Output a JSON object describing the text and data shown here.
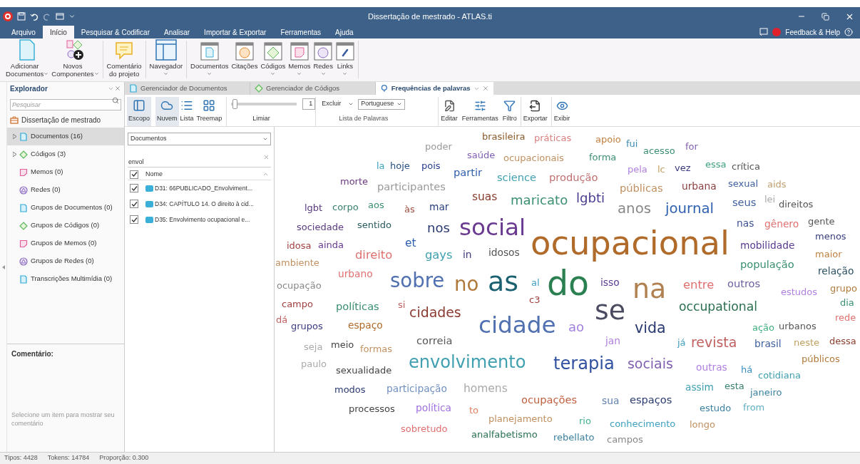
{
  "window": {
    "title": "Dissertação de mestrado - ATLAS.ti"
  },
  "menu_tabs": [
    {
      "label": "Arquivo",
      "selected": false
    },
    {
      "label": "Início",
      "selected": true
    },
    {
      "label": "Pesquisar & Codificar",
      "selected": false
    },
    {
      "label": "Analisar",
      "selected": false
    },
    {
      "label": "Importar & Exportar",
      "selected": false
    },
    {
      "label": "Ferramentas",
      "selected": false
    },
    {
      "label": "Ajuda",
      "selected": false
    }
  ],
  "feedback": "Feedback & Help",
  "ribbon": [
    {
      "kind": "doc",
      "lines": [
        "Adicionar",
        "Documentos"
      ],
      "dropdown": true,
      "group_end": false
    },
    {
      "kind": "components",
      "lines": [
        "Novos",
        "Componentes"
      ],
      "dropdown": true,
      "group_end": true
    },
    {
      "kind": "comment",
      "lines": [
        "Comentário",
        "do projeto"
      ],
      "dropdown": false,
      "group_end": true
    },
    {
      "kind": "navigator",
      "lines": [
        "Navegador"
      ],
      "dropdown": true,
      "group_end": true
    },
    {
      "kind": "documents",
      "lines": [
        "Documentos"
      ],
      "dropdown": true,
      "group_end": false
    },
    {
      "kind": "quotes",
      "lines": [
        "Citações"
      ],
      "dropdown": false,
      "group_end": false
    },
    {
      "kind": "codes",
      "lines": [
        "Códigos"
      ],
      "dropdown": true,
      "group_end": false
    },
    {
      "kind": "memos",
      "lines": [
        "Memos"
      ],
      "dropdown": true,
      "group_end": false
    },
    {
      "kind": "networks",
      "lines": [
        "Redes"
      ],
      "dropdown": true,
      "group_end": false
    },
    {
      "kind": "links",
      "lines": [
        "Links"
      ],
      "dropdown": true,
      "group_end": true
    }
  ],
  "explorer": {
    "title": "Explorador",
    "search_placeholder": "Pesquisar",
    "project": "Dissertação de mestrado",
    "items": [
      {
        "kind": "documents",
        "label": "Documentos (16)",
        "expandable": true,
        "selected": true
      },
      {
        "kind": "codes",
        "label": "Códigos (3)",
        "expandable": true,
        "selected": false
      },
      {
        "kind": "memos",
        "label": "Memos (0)",
        "expandable": false,
        "selected": false
      },
      {
        "kind": "networks",
        "label": "Redes (0)",
        "expandable": false,
        "selected": false
      },
      {
        "kind": "documents",
        "label": "Grupos de Documentos (0)",
        "expandable": false,
        "selected": false
      },
      {
        "kind": "codes",
        "label": "Grupos de Códigos (0)",
        "expandable": false,
        "selected": false
      },
      {
        "kind": "memos",
        "label": "Grupos de Memos (0)",
        "expandable": false,
        "selected": false
      },
      {
        "kind": "networks",
        "label": "Grupos de Redes (0)",
        "expandable": false,
        "selected": false
      },
      {
        "kind": "documents",
        "label": "Transcrições Multimídia (0)",
        "expandable": false,
        "selected": false
      }
    ],
    "comment_title": "Comentário:",
    "comment_hint": "Selecione um item para mostrar seu comentário"
  },
  "doc_tabs": [
    {
      "label": "Gerenciador de Documentos",
      "kind": "documents",
      "selected": false
    },
    {
      "label": "Gerenciador de Códigos",
      "kind": "codes",
      "selected": false
    },
    {
      "label": "Frequências de palavras",
      "kind": "frequency",
      "selected": true
    }
  ],
  "toolbar": {
    "views": [
      {
        "kind": "scope",
        "label": "Escopo",
        "selected": true
      },
      {
        "kind": "cloud",
        "label": "Nuvem",
        "selected": true
      },
      {
        "kind": "list",
        "label": "Lista",
        "selected": false
      },
      {
        "kind": "treemap",
        "label": "Treemap",
        "selected": false
      }
    ],
    "threshold": {
      "level": 0.02,
      "value": "1",
      "label": "Limiar"
    },
    "exclude": "Excluir",
    "language": "Portuguese",
    "word_list_label": "Lista de Palavras",
    "actions": [
      {
        "kind": "edit",
        "label": "Editar"
      },
      {
        "kind": "tools",
        "label": "Ferramentas"
      },
      {
        "kind": "filter",
        "label": "Filtro"
      },
      {
        "kind": "export",
        "label": "Exportar"
      },
      {
        "kind": "view",
        "label": "Exibir"
      }
    ]
  },
  "doc_filter": {
    "scope": "Documentos",
    "search": "envol",
    "header": "Nome",
    "header_checked": true,
    "rows": [
      {
        "name": "D31: 66PUBLICADO_Envolviment...",
        "checked": true
      },
      {
        "name": "D34: CAPÍTULO 14. O direito à cid...",
        "checked": true
      },
      {
        "name": "D35: Envolvimento ocupacional e...",
        "checked": true
      }
    ]
  },
  "word_cloud": [
    {
      "text": "poder",
      "color": "#999999"
    },
    {
      "text": "brasileira",
      "color": "#8a5a2b"
    },
    {
      "text": "práticas",
      "color": "#d98080"
    },
    {
      "text": "apoio",
      "color": "#c08040"
    },
    {
      "text": "fui",
      "color": "#3a8ab0"
    },
    {
      "text": "acesso",
      "color": "#3a9070"
    },
    {
      "text": "for",
      "color": "#8060b0"
    },
    {
      "text": "la",
      "color": "#40a0c0"
    },
    {
      "text": "hoje",
      "color": "#2a5080"
    },
    {
      "text": "pois",
      "color": "#2a4090"
    },
    {
      "text": "saúde",
      "color": "#8060b0"
    },
    {
      "text": "ocupacionais",
      "color": "#c09060"
    },
    {
      "text": "forma",
      "color": "#3a9070"
    },
    {
      "text": "pela",
      "color": "#b080e0"
    },
    {
      "text": "lc",
      "color": "#c0a060"
    },
    {
      "text": "vez",
      "color": "#3a3a80"
    },
    {
      "text": "essa",
      "color": "#40a080"
    },
    {
      "text": "crítica",
      "color": "#555555"
    },
    {
      "text": "morte",
      "color": "#6a3a80"
    },
    {
      "text": "participantes",
      "color": "#999999"
    },
    {
      "text": "partir",
      "color": "#3060b0"
    },
    {
      "text": "science",
      "color": "#40a0b0"
    },
    {
      "text": "produção",
      "color": "#c07070"
    },
    {
      "text": "públicas",
      "color": "#c09060"
    },
    {
      "text": "urbana",
      "color": "#8a4040"
    },
    {
      "text": "sexual",
      "color": "#4060a0"
    },
    {
      "text": "aids",
      "color": "#c0a070"
    },
    {
      "text": "lgbt",
      "color": "#5a3a80"
    },
    {
      "text": "corpo",
      "color": "#3a8070"
    },
    {
      "text": "aos",
      "color": "#3a9070"
    },
    {
      "text": "às",
      "color": "#a05040"
    },
    {
      "text": "mar",
      "color": "#2a4080"
    },
    {
      "text": "suas",
      "color": "#8a4030"
    },
    {
      "text": "maricato",
      "color": "#3a9070"
    },
    {
      "text": "lgbti",
      "color": "#4a3a90"
    },
    {
      "text": "anos",
      "color": "#888888"
    },
    {
      "text": "journal",
      "color": "#3060b0"
    },
    {
      "text": "seus",
      "color": "#4060a0"
    },
    {
      "text": "lei",
      "color": "#aaaaaa"
    },
    {
      "text": "direitos",
      "color": "#555555"
    },
    {
      "text": "sociedade",
      "color": "#5a3a80"
    },
    {
      "text": "sentido",
      "color": "#2a5a60"
    },
    {
      "text": "nos",
      "color": "#2a3a70"
    },
    {
      "text": "social",
      "color": "#6a3a90"
    },
    {
      "text": "nas",
      "color": "#3a5090"
    },
    {
      "text": "gênero",
      "color": "#e07070"
    },
    {
      "text": "gente",
      "color": "#555555"
    },
    {
      "text": "menos",
      "color": "#3a4080"
    },
    {
      "text": "idosa",
      "color": "#a04040"
    },
    {
      "text": "ainda",
      "color": "#6a3a90"
    },
    {
      "text": "direito",
      "color": "#e07070"
    },
    {
      "text": "et",
      "color": "#3060b0"
    },
    {
      "text": "gays",
      "color": "#40a0b0"
    },
    {
      "text": "in",
      "color": "#3a3a80"
    },
    {
      "text": "idosos",
      "color": "#555555"
    },
    {
      "text": "ocupacional",
      "color": "#b06a2a"
    },
    {
      "text": "mobilidade",
      "color": "#5a3a90"
    },
    {
      "text": "maior",
      "color": "#c08040"
    },
    {
      "text": "ambiente",
      "color": "#c09060"
    },
    {
      "text": "urbano",
      "color": "#e07070"
    },
    {
      "text": "população",
      "color": "#3a9070"
    },
    {
      "text": "relação",
      "color": "#2a5060"
    },
    {
      "text": "ocupação",
      "color": "#888888"
    },
    {
      "text": "sobre",
      "color": "#5070b0"
    },
    {
      "text": "no",
      "color": "#b07a3a"
    },
    {
      "text": "as",
      "color": "#1a6070"
    },
    {
      "text": "al",
      "color": "#40a0c0"
    },
    {
      "text": "do",
      "color": "#2a8050"
    },
    {
      "text": "isso",
      "color": "#5a3a90"
    },
    {
      "text": "na",
      "color": "#b08050"
    },
    {
      "text": "entre",
      "color": "#e07070"
    },
    {
      "text": "outros",
      "color": "#7060a0"
    },
    {
      "text": "estudos",
      "color": "#b080e0"
    },
    {
      "text": "grupo",
      "color": "#b07a3a"
    },
    {
      "text": "campo",
      "color": "#a04040"
    },
    {
      "text": "políticas",
      "color": "#3a9070"
    },
    {
      "text": "si",
      "color": "#c06060"
    },
    {
      "text": "cidades",
      "color": "#8a3a30"
    },
    {
      "text": "c3",
      "color": "#a04040"
    },
    {
      "text": "se",
      "color": "#4a4a60"
    },
    {
      "text": "occupational",
      "color": "#2a7050"
    },
    {
      "text": "dia",
      "color": "#3a9070"
    },
    {
      "text": "dá",
      "color": "#c06060"
    },
    {
      "text": "grupos",
      "color": "#3a3a80"
    },
    {
      "text": "espaço",
      "color": "#b06a2a"
    },
    {
      "text": "cidade",
      "color": "#5070b0"
    },
    {
      "text": "ao",
      "color": "#a080e0"
    },
    {
      "text": "vida",
      "color": "#2a3a70"
    },
    {
      "text": "ação",
      "color": "#40b080"
    },
    {
      "text": "urbanos",
      "color": "#555555"
    },
    {
      "text": "rede",
      "color": "#e07070"
    },
    {
      "text": "seja",
      "color": "#aaaaaa"
    },
    {
      "text": "meio",
      "color": "#444444"
    },
    {
      "text": "formas",
      "color": "#c09060"
    },
    {
      "text": "correia",
      "color": "#555555"
    },
    {
      "text": "jan",
      "color": "#b080e0"
    },
    {
      "text": "já",
      "color": "#40a0c0"
    },
    {
      "text": "revista",
      "color": "#c06060"
    },
    {
      "text": "brasil",
      "color": "#4060a0"
    },
    {
      "text": "neste",
      "color": "#c0a060"
    },
    {
      "text": "dessa",
      "color": "#8a4030"
    },
    {
      "text": "paulo",
      "color": "#aaaaaa"
    },
    {
      "text": "sexualidade",
      "color": "#444444"
    },
    {
      "text": "envolvimento",
      "color": "#40a0b0"
    },
    {
      "text": "terapia",
      "color": "#3050a0"
    },
    {
      "text": "sociais",
      "color": "#8060b0"
    },
    {
      "text": "outras",
      "color": "#b080e0"
    },
    {
      "text": "há",
      "color": "#3a90c0"
    },
    {
      "text": "cotidiana",
      "color": "#40a0b0"
    },
    {
      "text": "públicos",
      "color": "#b07a3a"
    },
    {
      "text": "modos",
      "color": "#2a3a70"
    },
    {
      "text": "participação",
      "color": "#7090c0"
    },
    {
      "text": "homens",
      "color": "#aaaaaa"
    },
    {
      "text": "assim",
      "color": "#40a0b0"
    },
    {
      "text": "esta",
      "color": "#3a8070"
    },
    {
      "text": "janeiro",
      "color": "#3a80a0"
    },
    {
      "text": "processos",
      "color": "#444444"
    },
    {
      "text": "política",
      "color": "#a070e0"
    },
    {
      "text": "to",
      "color": "#e08060"
    },
    {
      "text": "ocupações",
      "color": "#c06040"
    },
    {
      "text": "sua",
      "color": "#6080b0"
    },
    {
      "text": "espaços",
      "color": "#2a3a70"
    },
    {
      "text": "estudo",
      "color": "#3a80a0"
    },
    {
      "text": "from",
      "color": "#60b0c0"
    },
    {
      "text": "sobretudo",
      "color": "#e07070"
    },
    {
      "text": "planejamento",
      "color": "#c09060"
    },
    {
      "text": "rio",
      "color": "#40b090"
    },
    {
      "text": "conhecimento",
      "color": "#40a0c0"
    },
    {
      "text": "longo",
      "color": "#c09060"
    },
    {
      "text": "analfabetismo",
      "color": "#2a7050"
    },
    {
      "text": "rebellato",
      "color": "#3a80a0"
    },
    {
      "text": "campos",
      "color": "#888888"
    }
  ],
  "status_bar": [
    {
      "label": "Tipos: 4428"
    },
    {
      "label": "Tokens: 14784"
    },
    {
      "label": "Proporção: 0.300"
    }
  ]
}
